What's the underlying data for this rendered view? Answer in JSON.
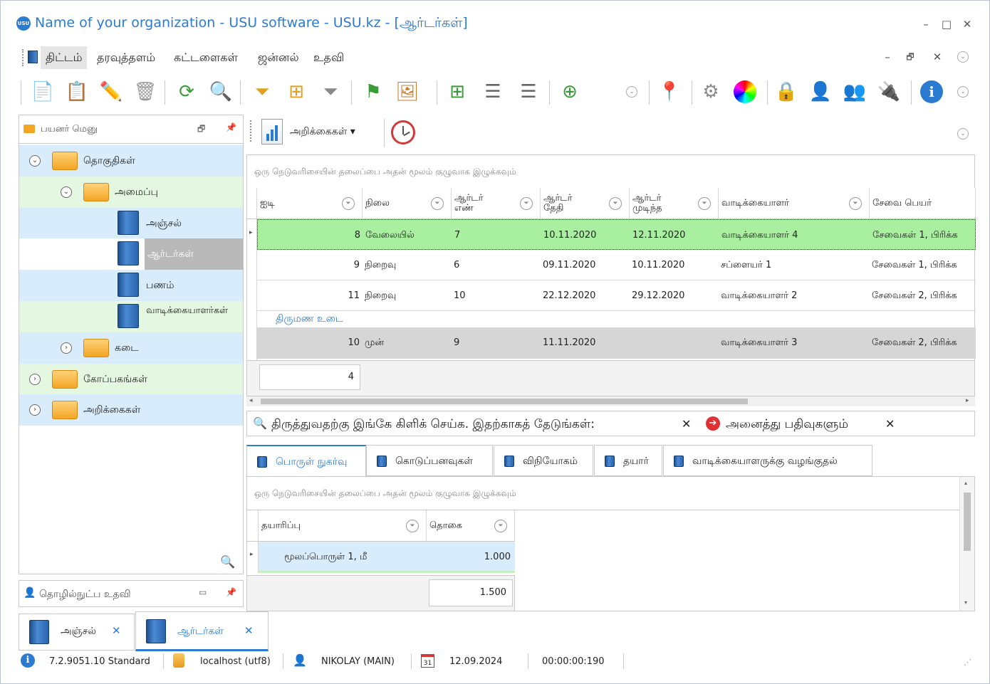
{
  "window": {
    "title": "Name of your organization - USU software - USU.kz - [ஆர்டர்கள்]",
    "logo": "USU",
    "minimize": "–",
    "maximize": "□",
    "close": "✕"
  },
  "menu": {
    "items": [
      "திட்டம்",
      "தரவுத்தளம்",
      "கட்டளைகள்",
      "ஜன்னல்",
      "உதவி"
    ]
  },
  "inner_controls": {
    "minimize": "–",
    "restore": "🗗",
    "close": "✕"
  },
  "sidebar": {
    "header": "பயனர் மெனு",
    "items": [
      {
        "label": "தொகுதிகள்",
        "level": 0,
        "expanded": true
      },
      {
        "label": "அமைப்பு",
        "level": 1,
        "expanded": true
      },
      {
        "label": "அஞ்சல்",
        "level": 2
      },
      {
        "label": "ஆர்டர்கள்",
        "level": 2,
        "selected": true
      },
      {
        "label": "பணம்",
        "level": 2
      },
      {
        "label": "வாடிக்கையாளர்கள்",
        "level": 2
      },
      {
        "label": "கடை",
        "level": 1,
        "expanded": false
      },
      {
        "label": "கோப்பகங்கள்",
        "level": 0,
        "expanded": false
      },
      {
        "label": "அறிக்கைகள்",
        "level": 0,
        "expanded": false
      }
    ],
    "tech_help": "தொழில்நுட்ப உதவி"
  },
  "reports_bar": {
    "label": "அறிக்கைகள்"
  },
  "grid": {
    "group_hint": "ஒரு நெடுவரிசையின் தலைப்பை அதன் மூலம் குழுவாக இழுக்கவும்",
    "columns": [
      "ஐடி",
      "நிலை",
      "ஆர்டர் எண்",
      "ஆர்டர் தேதி",
      "ஆர்டர் முடிந்த",
      "வாடிக்கையாளர்",
      "சேவை பெயர்"
    ],
    "rows": [
      {
        "id": "8",
        "status": "வேலையில்",
        "num": "7",
        "date": "10.11.2020",
        "done": "12.11.2020",
        "client": "வாடிக்கையாளர் 4",
        "service": "சேவைகள் 1, பிரிக்க"
      },
      {
        "id": "9",
        "status": "நிறைவு",
        "num": "6",
        "date": "09.11.2020",
        "done": "10.11.2020",
        "client": "சப்ளையர் 1",
        "service": "சேவைகள் 1, பிரிக்க"
      },
      {
        "id": "11",
        "status": "நிறைவு",
        "num": "10",
        "date": "22.12.2020",
        "done": "29.12.2020",
        "client": "வாடிக்கையாளர் 2",
        "service": "சேவைகள் 2, பிரிக்க"
      }
    ],
    "subrow_link": "திருமண உடை",
    "last_row": {
      "id": "10",
      "status": "முன்",
      "num": "9",
      "date": "11.11.2020",
      "done": "",
      "client": "வாடிக்கையாளர் 3",
      "service": "சேவைகள் 2, பிரிக்க"
    },
    "count": "4"
  },
  "searchbar": {
    "text": "திருத்துவதற்கு இங்கே கிளிக் செய்க. இதற்காகத் தேடுங்கள்:",
    "all_records": "அனைத்து பதிவுகளும்",
    "clear": "✕"
  },
  "lower_tabs": [
    "பொருள் நுகர்வு",
    "கொடுப்பனவுகள்",
    "விநியோகம்",
    "தயார்",
    "வாடிக்கையாளருக்கு வழங்குதல்"
  ],
  "subgrid": {
    "group_hint": "ஒரு நெடுவரிசையின் தலைப்பை அதன் மூலம் குழுவாக இழுக்கவும்",
    "columns": [
      "தயாரிப்பு",
      "தொகை"
    ],
    "rows": [
      {
        "product": "மூலப்பொருள் 1, மீ",
        "amount": "1.000"
      }
    ],
    "total": "1.500"
  },
  "doc_tabs": [
    "அஞ்சல்",
    "ஆர்டர்கள்"
  ],
  "status": {
    "version": "7.2.9051.10 Standard",
    "db": "localhost (utf8)",
    "user": "NIKOLAY (MAIN)",
    "date": "12.09.2024",
    "timer": "00:00:00:190",
    "calendar_day": "31"
  }
}
